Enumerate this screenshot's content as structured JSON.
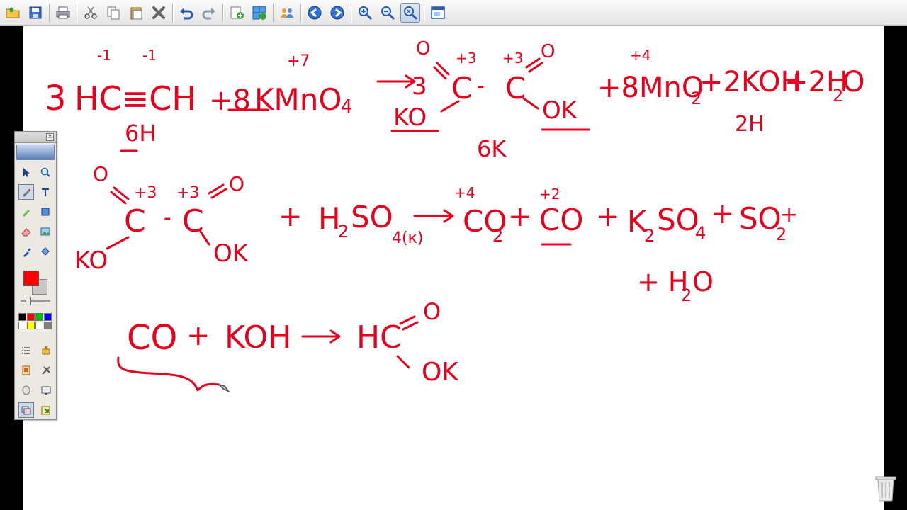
{
  "toolbar": {
    "buttons": [
      {
        "name": "open-icon"
      },
      {
        "name": "save-icon"
      },
      {
        "sep": true
      },
      {
        "name": "print-icon"
      },
      {
        "sep": true
      },
      {
        "name": "cut-icon"
      },
      {
        "name": "copy-icon"
      },
      {
        "name": "paste-icon"
      },
      {
        "name": "delete-icon"
      },
      {
        "sep": true
      },
      {
        "name": "undo-icon"
      },
      {
        "name": "redo-icon"
      },
      {
        "sep": true
      },
      {
        "name": "new-page-icon"
      },
      {
        "name": "duplicate-page-icon"
      },
      {
        "sep": true
      },
      {
        "name": "users-icon"
      },
      {
        "sep": true
      },
      {
        "name": "prev-page-icon"
      },
      {
        "name": "next-page-icon"
      },
      {
        "sep": true
      },
      {
        "name": "zoom-in-icon"
      },
      {
        "name": "zoom-out-icon"
      },
      {
        "name": "zoom-fit-icon",
        "active": true
      },
      {
        "sep": true
      },
      {
        "name": "window-icon"
      }
    ]
  },
  "palette": {
    "close_label": "x",
    "foreground_color": "#ff0000",
    "background_color": "#c8c8c8",
    "swatch_colors": [
      "#000000",
      "#ff0000",
      "#00c000",
      "#0000ff",
      "#ffffff",
      "#ffff00",
      "#ffffff",
      "#808080"
    ]
  },
  "board": {
    "ink_color": "#e8001c",
    "line1": {
      "coef1": "3",
      "reactant1": "HC≡CH",
      "ox_c1": "-1",
      "ox_c2": "-1",
      "plus1": "+8",
      "reactant2": "KMnO",
      "sub_o4": "4",
      "ox_mn": "+7",
      "product_coef": "3",
      "ox_c3": "+3",
      "ox_c4": "+3",
      "o_left": "O",
      "o_right": "O",
      "c_left": "C",
      "dash": "-",
      "c_right": "C",
      "ko": "KO",
      "ok": "OK",
      "mno2": "+8MnO",
      "sub_2a": "2",
      "ox_mn2": "+4",
      "koh": "+2KOH",
      "h2o": "+2H",
      "sub_2b": "2",
      "o_end": "O",
      "note_6h": "6H",
      "note_6k": "6K",
      "note_2h": "2H"
    },
    "line2": {
      "o_top": "O",
      "ox1": "+3",
      "ox2": "+3",
      "o_top2": "O",
      "c1": "C",
      "dash": "-",
      "c2": "C",
      "ko": "KO",
      "ok": "OK",
      "plus": "+",
      "h2so4": "H",
      "sub_2": "2",
      "so": "SO",
      "sub_4k": "4(к)",
      "co2": "CO",
      "sub_2b": "2",
      "ox_co2": "+4",
      "plus2": "+",
      "co": "CO",
      "ox_co": "+2",
      "plus3": "+",
      "k2so4": "K",
      "sub_k2": "2",
      "so4": "SO",
      "sub_4": "4",
      "plus4": "+",
      "so2": "SO",
      "sub_so2": "2",
      "plus5": "+",
      "h2o": "+ H",
      "sub_h2o": "2",
      "o_h2o": "O"
    },
    "line3": {
      "co": "CO",
      "plus": "+",
      "koh": "KOH",
      "hc": "HC",
      "o": "O",
      "ok": "OK"
    }
  }
}
